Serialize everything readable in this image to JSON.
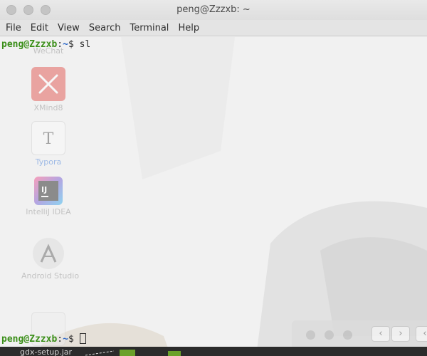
{
  "window": {
    "title": "peng@Zzzxb: ~"
  },
  "menu": [
    "File",
    "Edit",
    "View",
    "Search",
    "Terminal",
    "Help"
  ],
  "terminal": {
    "line1": {
      "user": "peng@Zzzxb",
      "sep": ":",
      "path": "~",
      "prompt": "$ ",
      "command": "sl"
    },
    "line2": {
      "user": "peng@Zzzxb",
      "sep": ":",
      "path": "~",
      "prompt": "$ ",
      "command": ""
    }
  },
  "desktop_icons": [
    {
      "label": "WeChat",
      "icon": "wechat-icon",
      "color": "#9e9e9e"
    },
    {
      "label": "XMind8",
      "icon": "xmind-icon",
      "color": "#e0463f"
    },
    {
      "label": "Typora",
      "icon": "typora-icon",
      "color": "#9a9a9a"
    },
    {
      "label": "IntelliJ IDEA",
      "icon": "intellij-icon",
      "color": "#6a4bd0"
    },
    {
      "label": "Android Studio",
      "icon": "android-studio-icon",
      "color": "#a0a0a0"
    }
  ],
  "taskbar": {
    "file_label": "gdx-setup.jar"
  }
}
